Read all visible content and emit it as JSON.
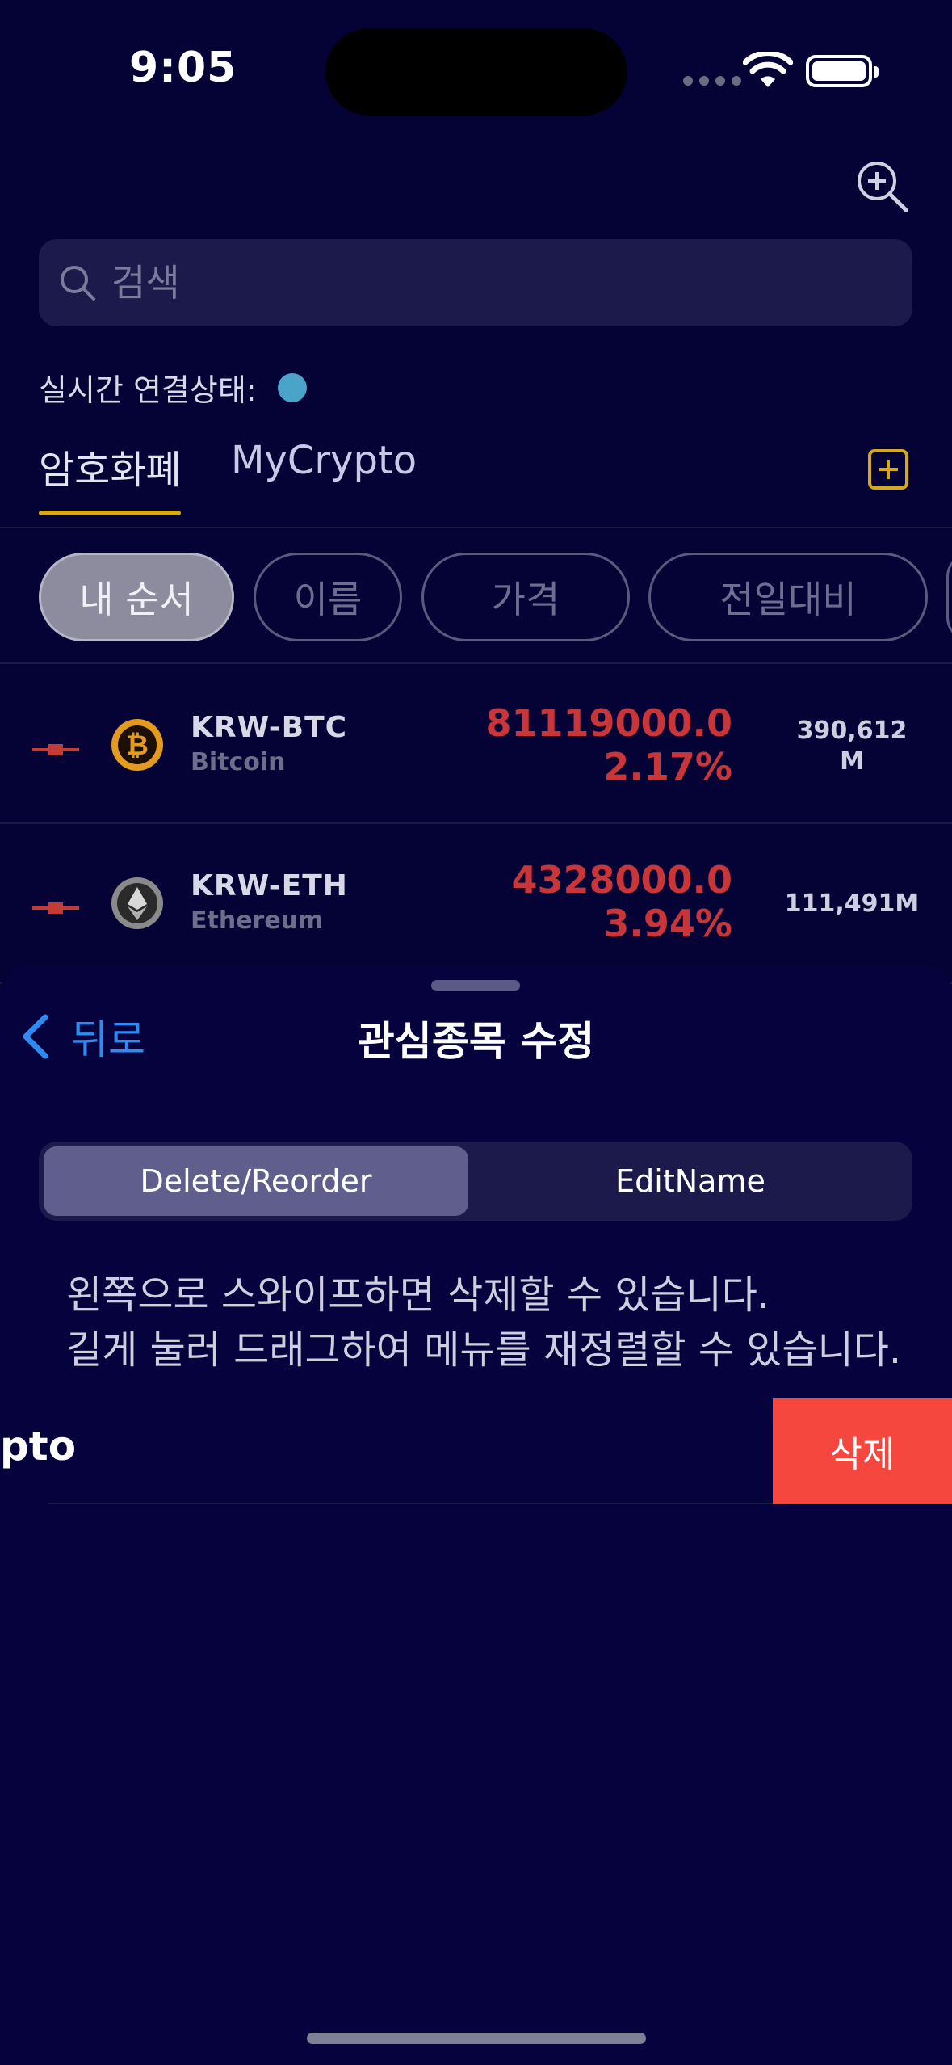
{
  "status": {
    "time": "9:05"
  },
  "search": {
    "placeholder": "검색"
  },
  "connection": {
    "label": "실시간 연결상태:",
    "dot_color": "#4aa3c9"
  },
  "tabs": [
    {
      "label": "암호화폐",
      "active": true
    },
    {
      "label": "MyCrypto",
      "active": false
    }
  ],
  "sort_chips": [
    {
      "label": "내 순서",
      "selected": true
    },
    {
      "label": "이름",
      "selected": false
    },
    {
      "label": "가격",
      "selected": false
    },
    {
      "label": "전일대비",
      "selected": false
    }
  ],
  "coins": [
    {
      "symbol": "KRW-BTC",
      "name": "Bitcoin",
      "price": "81119000.0",
      "rate": "2.17%",
      "volume_line1": "390,612",
      "volume_line2": "M",
      "icon": "bitcoin-icon"
    },
    {
      "symbol": "KRW-ETH",
      "name": "Ethereum",
      "price": "4328000.0",
      "rate": "3.94%",
      "volume_line1": "111,491M",
      "volume_line2": "",
      "icon": "ethereum-icon"
    }
  ],
  "sheet": {
    "back_label": "뒤로",
    "title": "관심종목 수정",
    "segments": {
      "delete_reorder": "Delete/Reorder",
      "edit_name": "EditName"
    },
    "hint_line1": "왼쪽으로 스와이프하면 삭제할 수 있습니다.",
    "hint_line2": "길게 눌러 드래그하여 메뉴를 재정렬할 수 있습니다.",
    "row_label": "pto",
    "delete_label": "삭제"
  },
  "colors": {
    "accent": "#d6a91a",
    "down_red": "#c9363a",
    "link_blue": "#2e8bf2",
    "delete_red": "#f5473e"
  }
}
